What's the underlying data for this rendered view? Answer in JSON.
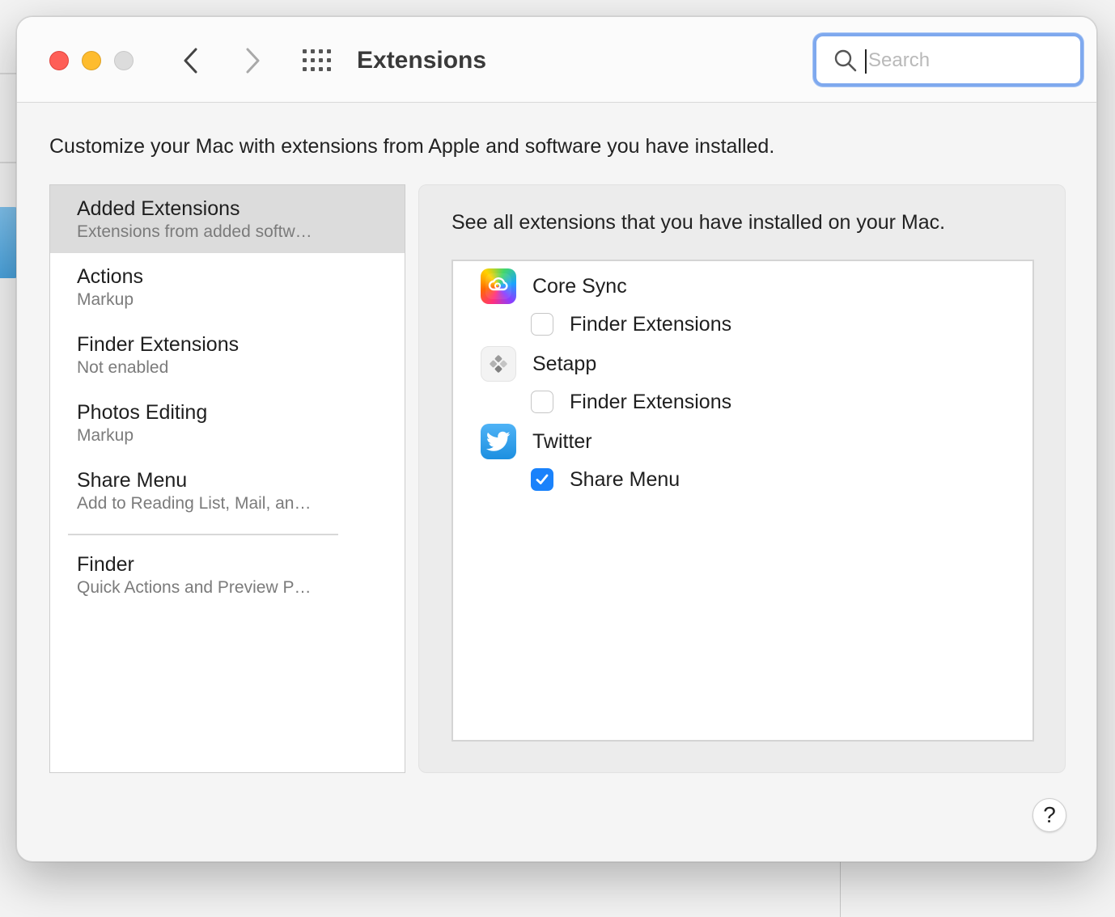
{
  "window": {
    "title": "Extensions"
  },
  "search": {
    "placeholder": "Search",
    "value": ""
  },
  "intro_text": "Customize your Mac with extensions from Apple and software you have installed.",
  "sidebar": {
    "items": [
      {
        "title": "Added Extensions",
        "subtitle": "Extensions from added softw…",
        "selected": true
      },
      {
        "title": "Actions",
        "subtitle": "Markup",
        "selected": false
      },
      {
        "title": "Finder Extensions",
        "subtitle": "Not enabled",
        "selected": false
      },
      {
        "title": "Photos Editing",
        "subtitle": "Markup",
        "selected": false
      },
      {
        "title": "Share Menu",
        "subtitle": "Add to Reading List, Mail, an…",
        "selected": false
      },
      {
        "title": "Finder",
        "subtitle": "Quick Actions and Preview P…",
        "selected": false
      }
    ]
  },
  "detail": {
    "description": "See all extensions that you have installed on your Mac.",
    "apps": [
      {
        "name": "Core Sync",
        "icon": "creative-cloud-icon",
        "extension": {
          "label": "Finder Extensions",
          "checked": false
        }
      },
      {
        "name": "Setapp",
        "icon": "setapp-icon",
        "extension": {
          "label": "Finder Extensions",
          "checked": false
        }
      },
      {
        "name": "Twitter",
        "icon": "twitter-icon",
        "extension": {
          "label": "Share Menu",
          "checked": true
        }
      }
    ]
  },
  "help": {
    "label": "?"
  },
  "colors": {
    "accent": "#1a82fb",
    "close": "#fe5f57",
    "minimize": "#febc2e",
    "focus_ring": "#7fa9ee"
  }
}
